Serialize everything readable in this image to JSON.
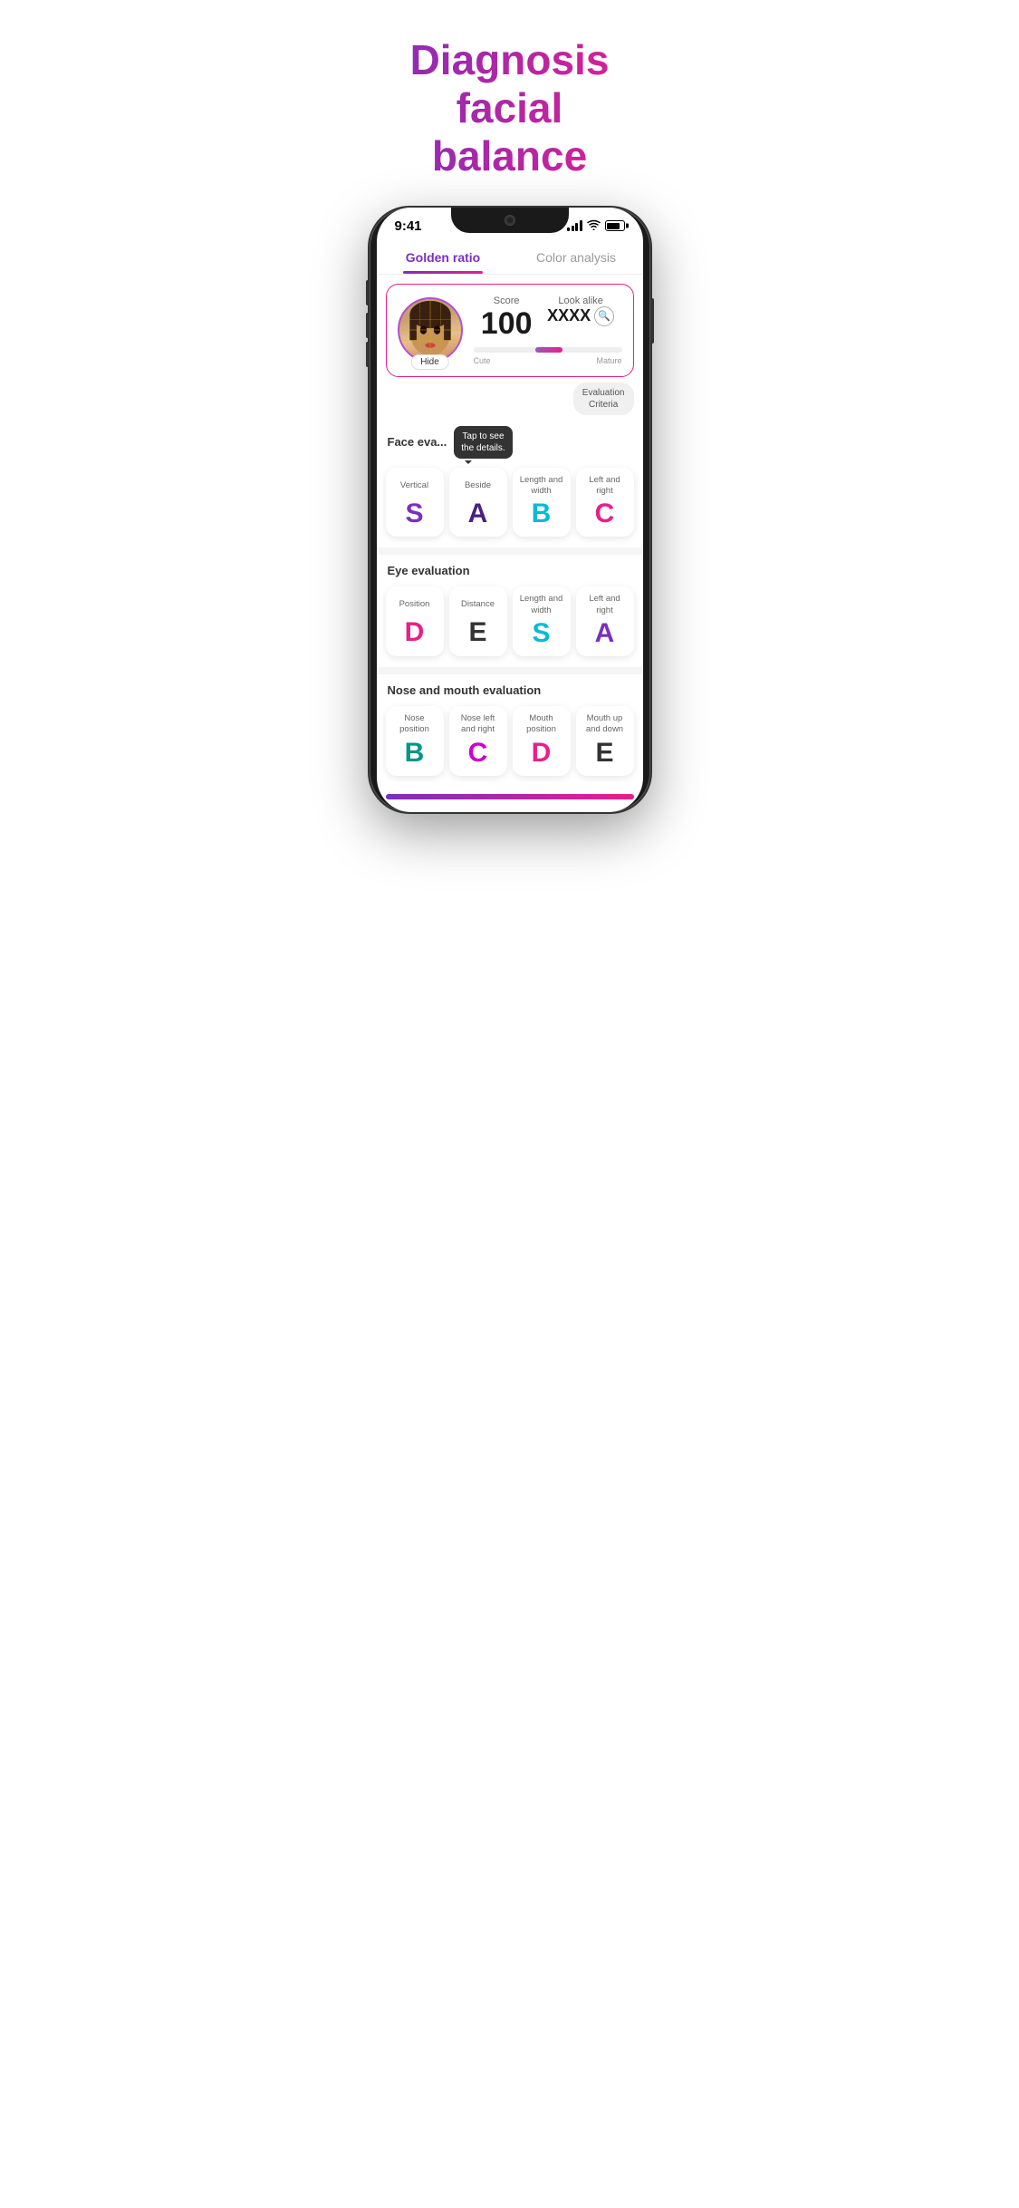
{
  "hero": {
    "title_line1": "Diagnosis facial",
    "title_line2": "balance"
  },
  "status_bar": {
    "time": "9:41",
    "signal": "4 bars",
    "wifi": "wifi",
    "battery": "full"
  },
  "tabs": [
    {
      "id": "golden-ratio",
      "label": "Golden ratio",
      "active": true
    },
    {
      "id": "color-analysis",
      "label": "Color analysis",
      "active": false
    }
  ],
  "score_card": {
    "hide_label": "Hide",
    "score_label": "Score",
    "score_value": "100",
    "lookalike_label": "Look alike",
    "lookalike_value": "XXXX",
    "progress_left": "Cute",
    "progress_right": "Mature"
  },
  "eval_criteria": {
    "label": "Evaluation\nCriteria"
  },
  "face_evaluation": {
    "title": "Face eva...",
    "tooltip": "Tap to see\nthe details.",
    "cards": [
      {
        "label": "Vertical",
        "grade": "S",
        "color": "grade-purple"
      },
      {
        "label": "Beside",
        "grade": "A",
        "color": "grade-dark-purple"
      },
      {
        "label": "Length and\nwidth",
        "grade": "B",
        "color": "grade-cyan"
      },
      {
        "label": "Left and\nright",
        "grade": "C",
        "color": "grade-pink"
      }
    ]
  },
  "eye_evaluation": {
    "title": "Eye evaluation",
    "cards": [
      {
        "label": "Position",
        "grade": "D",
        "color": "grade-pink"
      },
      {
        "label": "Distance",
        "grade": "E",
        "color": "grade-dark"
      },
      {
        "label": "Length and\nwidth",
        "grade": "S",
        "color": "grade-cyan"
      },
      {
        "label": "Left and\nright",
        "grade": "A",
        "color": "grade-purple"
      }
    ]
  },
  "nose_mouth_evaluation": {
    "title": "Nose and mouth evaluation",
    "cards": [
      {
        "label": "Nose\nposition",
        "grade": "B",
        "color": "grade-teal"
      },
      {
        "label": "Nose left\nand right",
        "grade": "C",
        "color": "grade-magenta"
      },
      {
        "label": "Mouth\nposition",
        "grade": "D",
        "color": "grade-pink"
      },
      {
        "label": "Mouth up\nand down",
        "grade": "E",
        "color": "grade-dark"
      }
    ]
  }
}
